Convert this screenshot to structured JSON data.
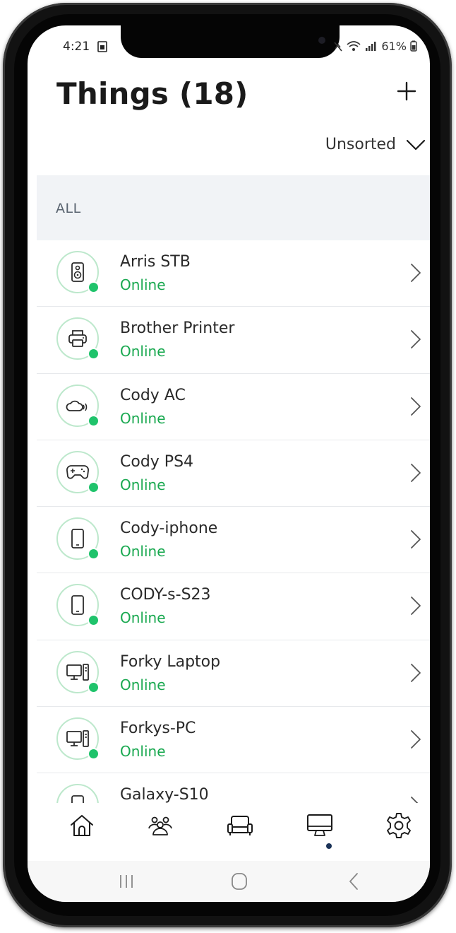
{
  "status_bar": {
    "time": "4:21",
    "right": "61%"
  },
  "header": {
    "title": "Things (18)",
    "add_icon": "plus-icon"
  },
  "sort": {
    "label": "Unsorted",
    "icon": "chevron-down-icon"
  },
  "section": {
    "label": "ALL"
  },
  "devices": [
    {
      "name": "Arris STB",
      "status": "Online",
      "icon": "speaker-icon"
    },
    {
      "name": "Brother Printer",
      "status": "Online",
      "icon": "printer-icon"
    },
    {
      "name": "Cody AC",
      "status": "Online",
      "icon": "cloud-wifi-icon"
    },
    {
      "name": "Cody PS4",
      "status": "Online",
      "icon": "gamepad-icon"
    },
    {
      "name": "Cody-iphone",
      "status": "Online",
      "icon": "phone-icon"
    },
    {
      "name": "CODY-s-S23",
      "status": "Online",
      "icon": "phone-icon"
    },
    {
      "name": "Forky Laptop",
      "status": "Online",
      "icon": "desktop-icon"
    },
    {
      "name": "Forkys-PC",
      "status": "Online",
      "icon": "desktop-icon"
    },
    {
      "name": "Galaxy-S10",
      "status": "",
      "icon": "phone-icon"
    }
  ],
  "tabs": [
    {
      "icon": "home-icon",
      "active": false
    },
    {
      "icon": "people-icon",
      "active": false
    },
    {
      "icon": "sofa-icon",
      "active": false
    },
    {
      "icon": "monitor-icon",
      "active": true
    },
    {
      "icon": "settings-gear-icon",
      "active": false
    }
  ],
  "android_nav": [
    "recents-icon",
    "home-circle-icon",
    "back-icon"
  ],
  "colors": {
    "online": "#18a84f",
    "status_dot": "#1fc36b",
    "ring": "#bde8cc",
    "section_bg": "#f1f3f6",
    "active_tab_dot": "#1b3358"
  }
}
